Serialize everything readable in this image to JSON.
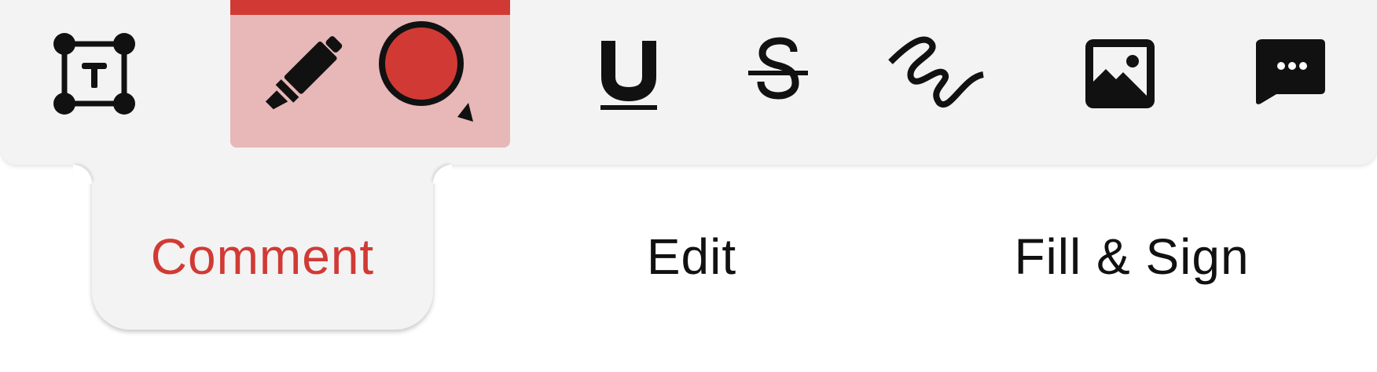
{
  "toolbar": {
    "tools": [
      {
        "id": "text-box",
        "icon": "text-box-icon"
      },
      {
        "id": "highlighter",
        "icon": "highlighter-icon",
        "selected": true
      },
      {
        "id": "color-picker",
        "icon": "color-circle-icon",
        "color": "#d13a34"
      },
      {
        "id": "underline",
        "icon": "underline-icon"
      },
      {
        "id": "strikethrough",
        "icon": "strikethrough-icon"
      },
      {
        "id": "freehand-draw",
        "icon": "squiggle-icon"
      },
      {
        "id": "add-image",
        "icon": "image-icon"
      },
      {
        "id": "sticky-note",
        "icon": "comment-bubble-icon"
      }
    ]
  },
  "tabs": {
    "comment_label": "Comment",
    "edit_label": "Edit",
    "fill_sign_label": "Fill & Sign",
    "active": "comment"
  },
  "colors": {
    "accent": "#d13a34",
    "selected_bg": "#e8b7b7",
    "toolbar_bg": "#f3f3f3",
    "icon": "#111111"
  }
}
